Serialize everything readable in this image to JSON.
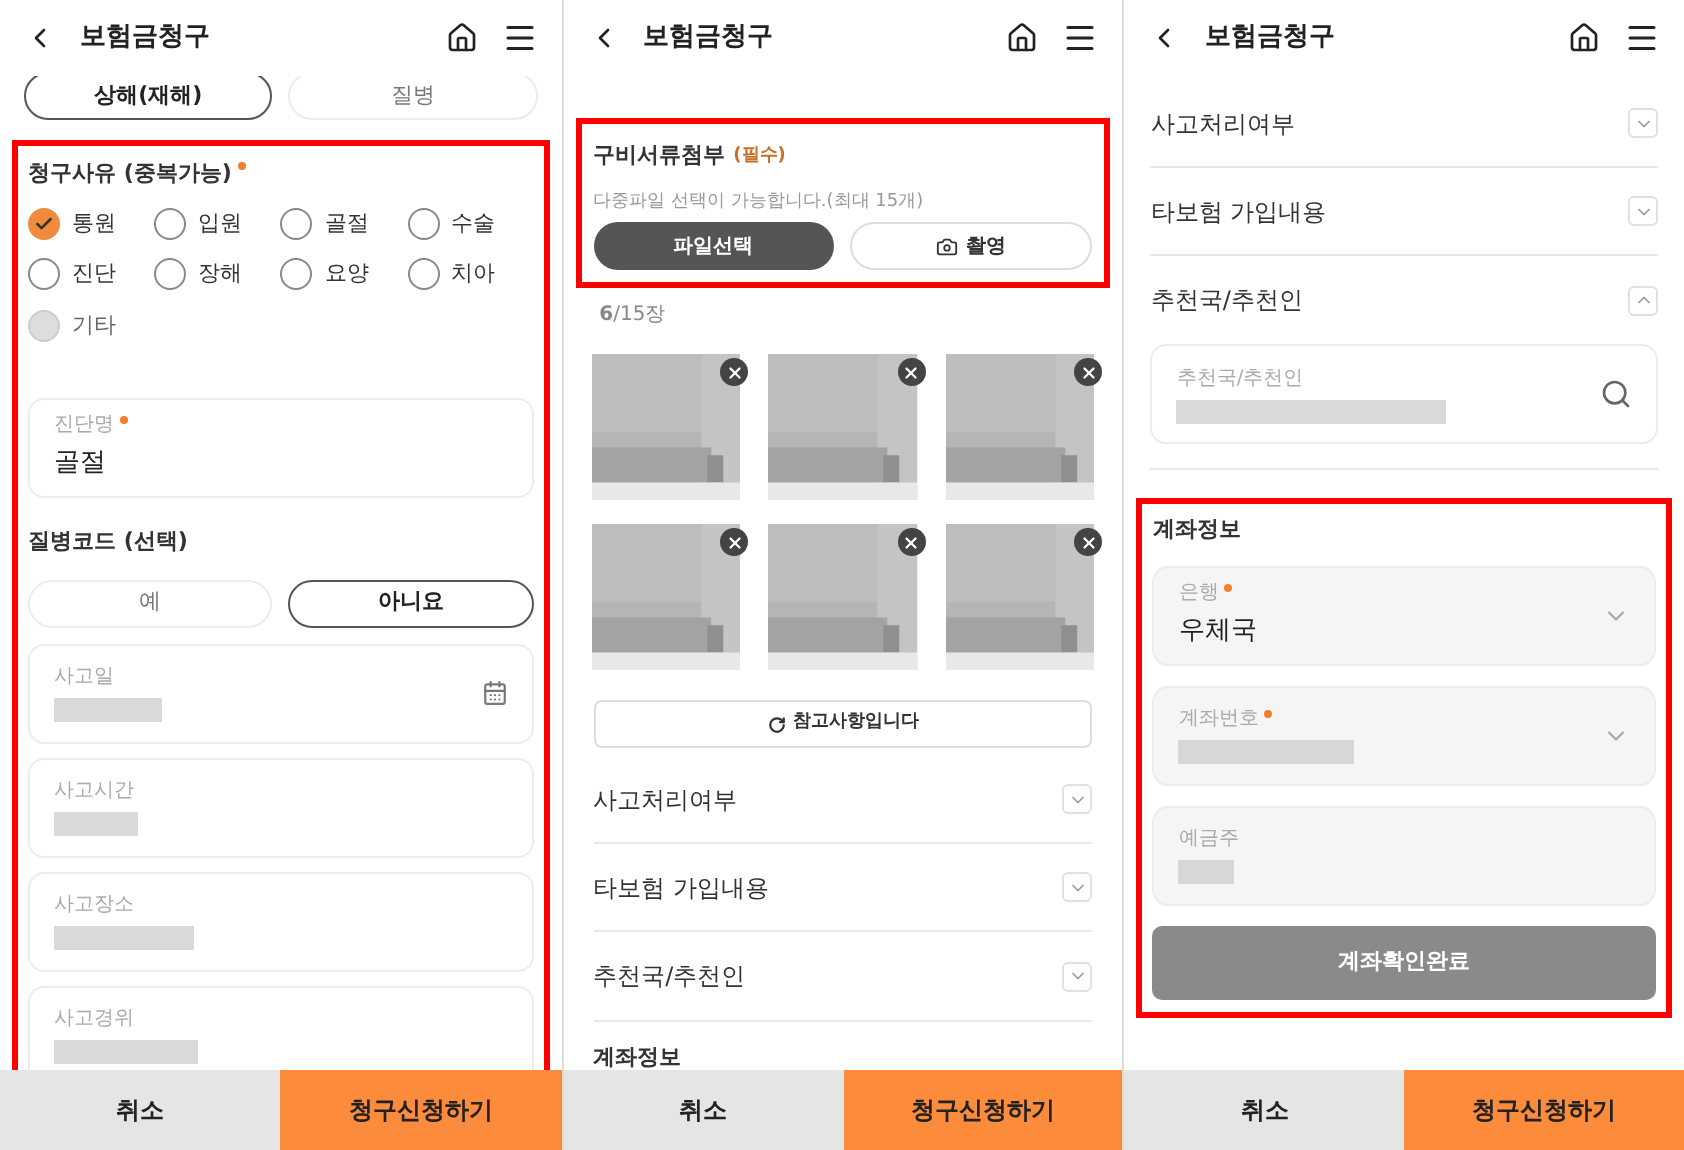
{
  "screens": [
    {
      "kind": "reason",
      "title": "보험금청구",
      "claim_type_tabs": [
        {
          "label": "상해(재해)",
          "selected": true
        },
        {
          "label": "질병",
          "selected": false
        }
      ],
      "reason_section": {
        "label": "청구사유 (중복가능)",
        "required": true,
        "highlighted": true,
        "options": [
          {
            "label": "통원",
            "checked": true,
            "disabled": false
          },
          {
            "label": "입원",
            "checked": false,
            "disabled": false
          },
          {
            "label": "골절",
            "checked": false,
            "disabled": false
          },
          {
            "label": "수술",
            "checked": false,
            "disabled": false
          },
          {
            "label": "진단",
            "checked": false,
            "disabled": false
          },
          {
            "label": "장해",
            "checked": false,
            "disabled": false
          },
          {
            "label": "요양",
            "checked": false,
            "disabled": false
          },
          {
            "label": "치아",
            "checked": false,
            "disabled": false
          },
          {
            "label": "기타",
            "checked": false,
            "disabled": true
          }
        ],
        "diagnosis_field": {
          "label": "진단명",
          "required": true,
          "value": "골절"
        },
        "disease_code": {
          "label": "질병코드 (선택)",
          "options": [
            {
              "label": "예",
              "selected": false
            },
            {
              "label": "아니요",
              "selected": true
            }
          ]
        },
        "fields": [
          {
            "label": "사고일",
            "kind": "date"
          },
          {
            "label": "사고시간",
            "kind": "text"
          },
          {
            "label": "사고장소",
            "kind": "text"
          },
          {
            "label": "사고경위",
            "kind": "text"
          }
        ]
      },
      "footer": {
        "cancel": "취소",
        "submit": "청구신청하기"
      }
    },
    {
      "kind": "attachment",
      "title": "보험금청구",
      "attachment": {
        "title": "구비서류첨부",
        "required_tag": "(필수)",
        "hint": "다중파일 선택이 가능합니다.(최대 15개)",
        "file_button": "파일선택",
        "camera_button": "촬영",
        "highlighted": true
      },
      "count": "**6**/15장",
      "photos": [
        {
          "kind": "picture"
        },
        {
          "kind": "picture"
        },
        {
          "kind": "picture"
        },
        {
          "kind": "picture"
        },
        {
          "kind": "picture"
        },
        {
          "kind": "picture"
        }
      ],
      "note_button": "참고사항입니다",
      "accordions": [
        {
          "label": "사고처리여부",
          "expanded": false
        },
        {
          "label": "타보험 가입내용",
          "expanded": false
        },
        {
          "label": "추천국/추천인",
          "expanded": false
        }
      ],
      "next_section_title": "계좌정보",
      "footer": {
        "cancel": "취소",
        "submit": "청구신청하기"
      }
    },
    {
      "kind": "account",
      "title": "보험금청구",
      "accordions": [
        {
          "label": "사고처리여부",
          "expanded": false
        },
        {
          "label": "타보험 가입내용",
          "expanded": false
        },
        {
          "label": "추천국/추천인",
          "expanded": true
        }
      ],
      "recommender_field": {
        "label": "추천국/추천인"
      },
      "account": {
        "title": "계좌정보",
        "highlighted": true,
        "fields": [
          {
            "label": "은행",
            "required": true,
            "value": "우체국",
            "kind": "select"
          },
          {
            "label": "계좌번호",
            "required": true,
            "kind": "select"
          },
          {
            "label": "예금주",
            "required": false,
            "kind": "text"
          }
        ],
        "confirm_button": {
          "label": "계좌확인완료",
          "disabled": true
        }
      },
      "footer": {
        "cancel": "취소",
        "submit": "청구신청하기"
      }
    }
  ]
}
